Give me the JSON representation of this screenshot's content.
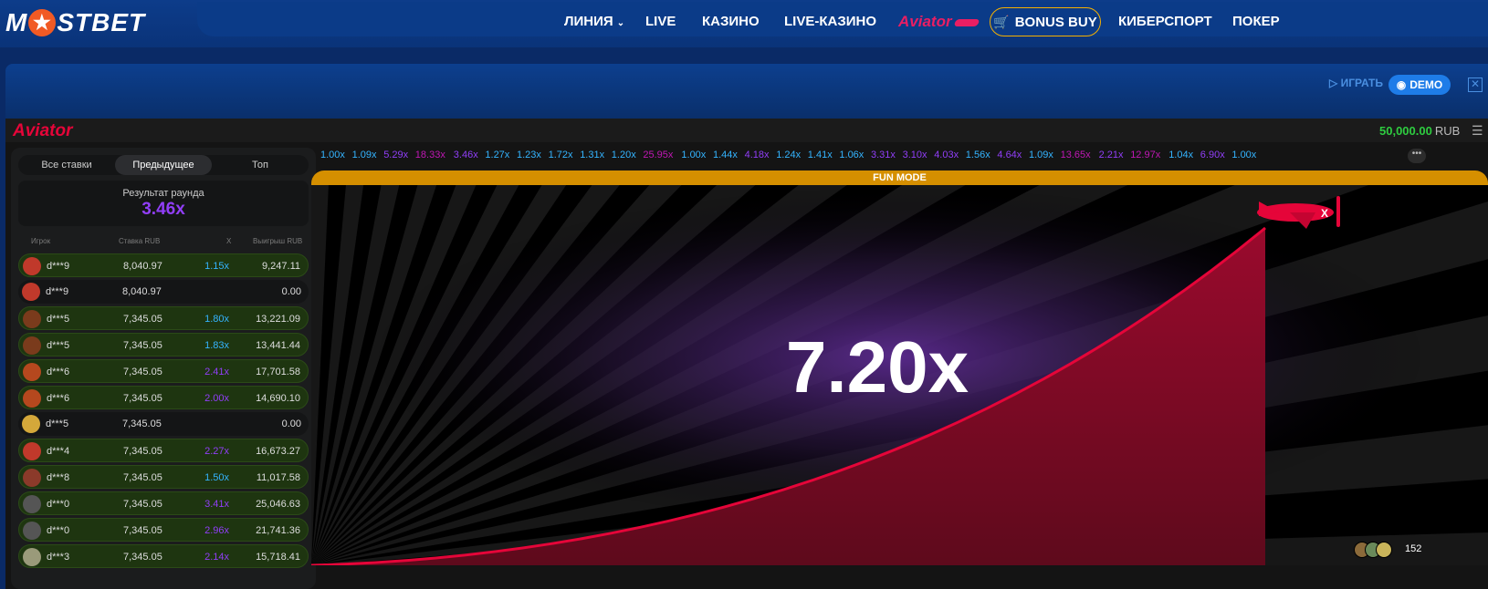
{
  "brand": {
    "logo_left": "M",
    "logo_star": "★",
    "logo_right": "STBET"
  },
  "nav": {
    "items": [
      "ЛИНИЯ",
      "LIVE",
      "КАЗИНО",
      "LIVE-КАЗИНО",
      "КИБЕРСПОРТ",
      "ПОКЕР"
    ],
    "aviator_label": "Aviator",
    "bonus_buy": "BONUS BUY"
  },
  "subbar": {
    "play_label": "ИГРАТЬ",
    "demo_label": "DEMO"
  },
  "game": {
    "logo": "Aviator",
    "balance": "50,000.00",
    "currency": "RUB",
    "fun_mode": "FUN MODE",
    "current_multiplier": "7.20x",
    "online_count": "152"
  },
  "left_panel": {
    "tabs": [
      "Все ставки",
      "Предыдущее",
      "Топ"
    ],
    "active_tab": "Предыдущее",
    "round_label": "Результат раунда",
    "round_value": "3.46x",
    "columns": [
      "Игрок",
      "Ставка RUB",
      "X",
      "Выигрыш RUB"
    ],
    "rows": [
      {
        "name": "d***9",
        "bet": "8,040.97",
        "mult": "1.15x",
        "payout": "9,247.11",
        "win": true,
        "color": "blue",
        "avatar": "#c0392b"
      },
      {
        "name": "d***9",
        "bet": "8,040.97",
        "mult": "",
        "payout": "0.00",
        "win": false,
        "color": "",
        "avatar": "#c0392b"
      },
      {
        "name": "d***5",
        "bet": "7,345.05",
        "mult": "1.80x",
        "payout": "13,221.09",
        "win": true,
        "color": "blue",
        "avatar": "#7a3b1c"
      },
      {
        "name": "d***5",
        "bet": "7,345.05",
        "mult": "1.83x",
        "payout": "13,441.44",
        "win": true,
        "color": "blue",
        "avatar": "#7a3b1c"
      },
      {
        "name": "d***6",
        "bet": "7,345.05",
        "mult": "2.41x",
        "payout": "17,701.58",
        "win": true,
        "color": "purple",
        "avatar": "#b5481e"
      },
      {
        "name": "d***6",
        "bet": "7,345.05",
        "mult": "2.00x",
        "payout": "14,690.10",
        "win": true,
        "color": "purple",
        "avatar": "#b5481e"
      },
      {
        "name": "d***5",
        "bet": "7,345.05",
        "mult": "",
        "payout": "0.00",
        "win": false,
        "color": "",
        "avatar": "#d4a83a"
      },
      {
        "name": "d***4",
        "bet": "7,345.05",
        "mult": "2.27x",
        "payout": "16,673.27",
        "win": true,
        "color": "purple",
        "avatar": "#c0392b"
      },
      {
        "name": "d***8",
        "bet": "7,345.05",
        "mult": "1.50x",
        "payout": "11,017.58",
        "win": true,
        "color": "blue",
        "avatar": "#8b3a2a"
      },
      {
        "name": "d***0",
        "bet": "7,345.05",
        "mult": "3.41x",
        "payout": "25,046.63",
        "win": true,
        "color": "purple",
        "avatar": "#555555"
      },
      {
        "name": "d***0",
        "bet": "7,345.05",
        "mult": "2.96x",
        "payout": "21,741.36",
        "win": true,
        "color": "purple",
        "avatar": "#555555"
      },
      {
        "name": "d***3",
        "bet": "7,345.05",
        "mult": "2.14x",
        "payout": "15,718.41",
        "win": true,
        "color": "purple",
        "avatar": "#9a9a7a"
      }
    ]
  },
  "history": [
    {
      "v": "1.00x",
      "c": "blue"
    },
    {
      "v": "1.09x",
      "c": "blue"
    },
    {
      "v": "5.29x",
      "c": "purple"
    },
    {
      "v": "18.33x",
      "c": "pink"
    },
    {
      "v": "3.46x",
      "c": "purple"
    },
    {
      "v": "1.27x",
      "c": "blue"
    },
    {
      "v": "1.23x",
      "c": "blue"
    },
    {
      "v": "1.72x",
      "c": "blue"
    },
    {
      "v": "1.31x",
      "c": "blue"
    },
    {
      "v": "1.20x",
      "c": "blue"
    },
    {
      "v": "25.95x",
      "c": "pink"
    },
    {
      "v": "1.00x",
      "c": "blue"
    },
    {
      "v": "1.44x",
      "c": "blue"
    },
    {
      "v": "4.18x",
      "c": "purple"
    },
    {
      "v": "1.24x",
      "c": "blue"
    },
    {
      "v": "1.41x",
      "c": "blue"
    },
    {
      "v": "1.06x",
      "c": "blue"
    },
    {
      "v": "3.31x",
      "c": "purple"
    },
    {
      "v": "3.10x",
      "c": "purple"
    },
    {
      "v": "4.03x",
      "c": "purple"
    },
    {
      "v": "1.56x",
      "c": "blue"
    },
    {
      "v": "4.64x",
      "c": "purple"
    },
    {
      "v": "1.09x",
      "c": "blue"
    },
    {
      "v": "13.65x",
      "c": "pink"
    },
    {
      "v": "2.21x",
      "c": "purple"
    },
    {
      "v": "12.97x",
      "c": "pink"
    },
    {
      "v": "1.04x",
      "c": "blue"
    },
    {
      "v": "6.90x",
      "c": "purple"
    },
    {
      "v": "1.00x",
      "c": "blue"
    }
  ],
  "icons": {
    "menu": "hamburger-icon",
    "close": "close-icon",
    "eye": "eye-icon",
    "cart": "cart-icon",
    "play": "play-icon"
  },
  "colors": {
    "win_row": "#1e3510",
    "multiplier_blue": "#34b4ff",
    "multiplier_purple": "#913ef8",
    "multiplier_pink": "#c017b4",
    "curve": "#e50539",
    "balance": "#2ecc40"
  }
}
